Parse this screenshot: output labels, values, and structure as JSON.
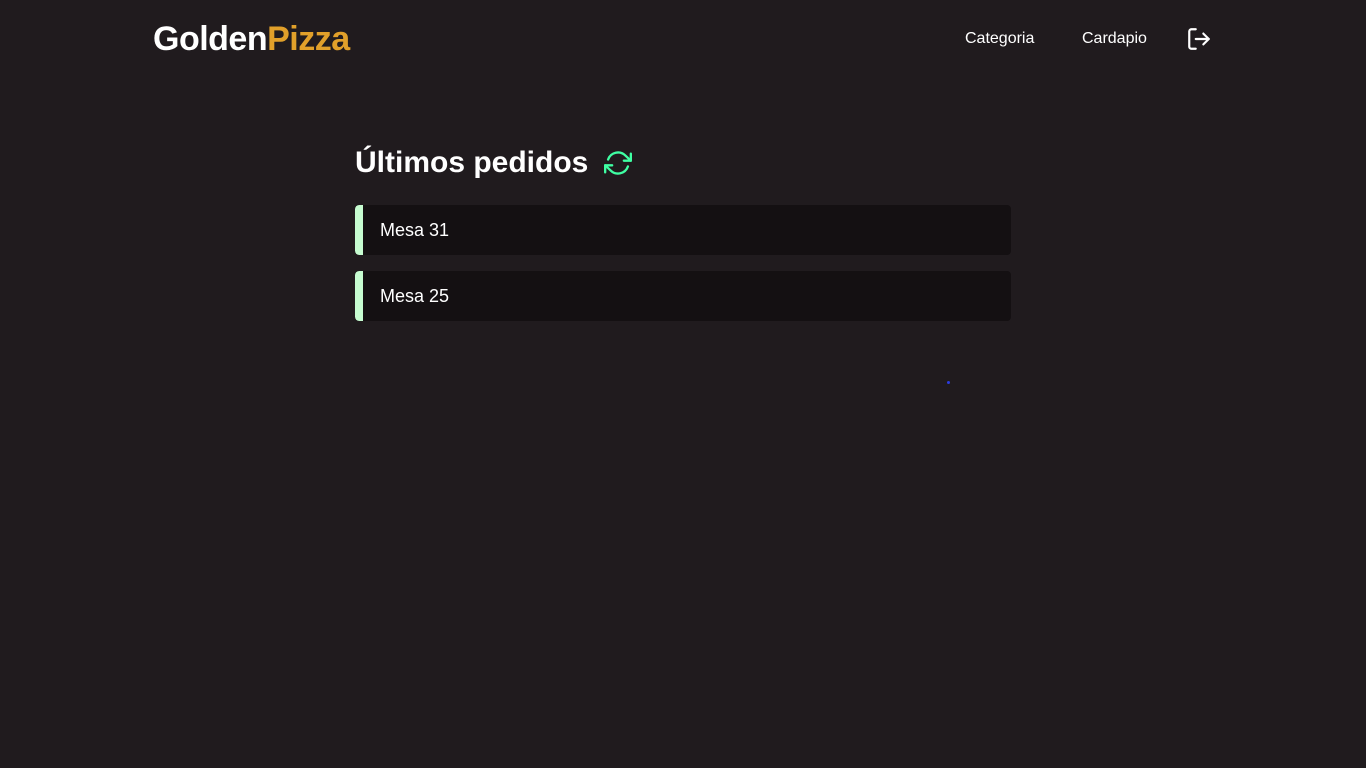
{
  "header": {
    "logo_part1": "Golden",
    "logo_part2": "Pizza",
    "nav": [
      {
        "label": "Categoria"
      },
      {
        "label": "Cardapio"
      }
    ],
    "logout_icon": "logout-icon"
  },
  "main": {
    "title": "Últimos pedidos",
    "refresh_icon": "refresh-icon",
    "orders": [
      {
        "label": "Mesa 31"
      },
      {
        "label": "Mesa 25"
      }
    ]
  },
  "colors": {
    "background": "#201b1e",
    "card": "#141012",
    "accent_gold": "#e1a02a",
    "accent_green": "#3fffa3",
    "order_bar": "#c6fcd0"
  }
}
